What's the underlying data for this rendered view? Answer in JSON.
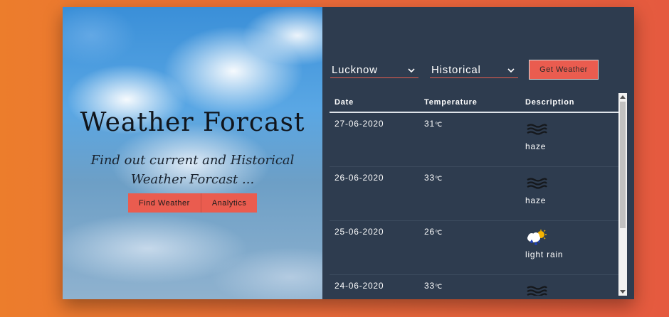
{
  "hero": {
    "title": "Weather Forcast",
    "subtitle": "Find out current and Historical Weather Forcast ...",
    "buttons": [
      "Find Weather",
      "Analytics"
    ]
  },
  "controls": {
    "city": "Lucknow",
    "mode": "Historical",
    "get_button": "Get Weather"
  },
  "table": {
    "headers": [
      "Date",
      "Temperature",
      "Description"
    ],
    "rows": [
      {
        "date": "27-06-2020",
        "temp": "31",
        "unit": "℃",
        "icon": "haze-icon",
        "desc": "haze"
      },
      {
        "date": "26-06-2020",
        "temp": "33",
        "unit": "℃",
        "icon": "haze-icon",
        "desc": "haze"
      },
      {
        "date": "25-06-2020",
        "temp": "26",
        "unit": "℃",
        "icon": "light-rain-icon",
        "desc": "light rain"
      },
      {
        "date": "24-06-2020",
        "temp": "33",
        "unit": "℃",
        "icon": "haze-icon",
        "desc": ""
      }
    ]
  },
  "colors": {
    "background_left": "#ec7d2c",
    "background_right": "#e55a3f",
    "panel": "#2e3c4f",
    "accent": "#ea5c4f"
  }
}
